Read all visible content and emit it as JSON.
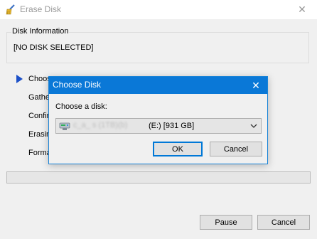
{
  "window": {
    "title": "Erase Disk",
    "close_glyph": "✕"
  },
  "disk_info": {
    "legend": "Disk Information",
    "value": "[NO DISK SELECTED]"
  },
  "steps": [
    {
      "label": "Choose"
    },
    {
      "label": "Gathe"
    },
    {
      "label": "Confir"
    },
    {
      "label": "Erasin"
    },
    {
      "label": "Forma"
    }
  ],
  "progress": {
    "value": 0
  },
  "buttons": {
    "pause": "Pause",
    "cancel": "Cancel"
  },
  "dialog": {
    "title": "Choose Disk",
    "close_glyph": "✕",
    "label": "Choose a disk:",
    "selected_disk": {
      "name": "c_a_ s (1TB)(b)",
      "detail": "(E:) [931 GB]"
    },
    "ok": "OK",
    "cancel": "Cancel"
  },
  "colors": {
    "accent": "#0a78d7",
    "step_arrow": "#1c50c8"
  },
  "icons": [
    "broom-icon",
    "close-icon",
    "play-arrow-icon",
    "drive-icon",
    "chevron-down-icon"
  ]
}
